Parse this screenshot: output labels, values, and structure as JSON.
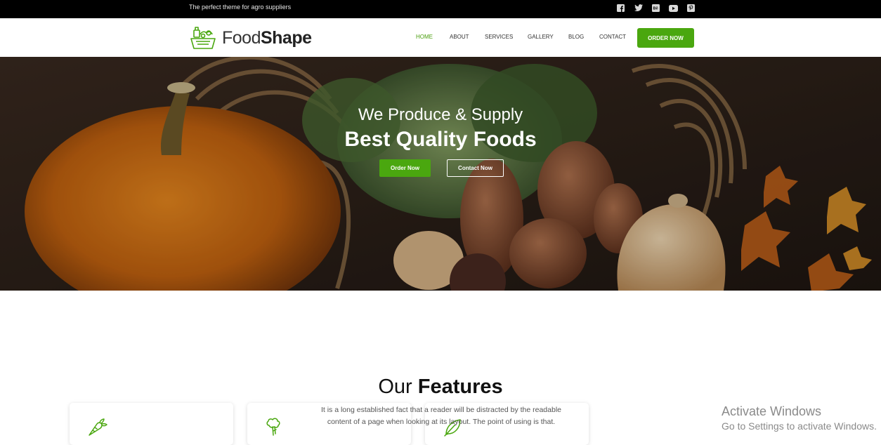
{
  "topbar": {
    "tagline": "The perfect theme for agro suppliers",
    "social_icons": [
      "facebook-icon",
      "twitter-icon",
      "behance-icon",
      "youtube-icon",
      "pinterest-icon"
    ]
  },
  "header": {
    "logo_light": "Food",
    "logo_bold": "Shape",
    "nav": [
      {
        "label": "HOME",
        "active": true
      },
      {
        "label": "ABOUT",
        "active": false
      },
      {
        "label": "SERVICES",
        "active": false
      },
      {
        "label": "GALLERY",
        "active": false
      },
      {
        "label": "BLOG",
        "active": false
      },
      {
        "label": "CONTACT",
        "active": false
      }
    ],
    "order_button": "ORDER NOW"
  },
  "hero": {
    "subtitle": "We Produce & Supply",
    "title": "Best Quality Foods",
    "primary_button": "Order Now",
    "secondary_button": "Contact Now"
  },
  "features": {
    "title_light": "Our",
    "title_bold": "Features",
    "description": "It is a long established fact that a reader will be distracted by the readable content of a page when looking at its layout. The point of using is that.",
    "card_icons": [
      "carrot-icon",
      "broccoli-icon",
      "leaf-icon"
    ]
  },
  "watermark": {
    "line1": "Activate Windows",
    "line2": "Go to Settings to activate Windows."
  },
  "colors": {
    "accent": "#4aa70f",
    "topbar": "#000000"
  }
}
